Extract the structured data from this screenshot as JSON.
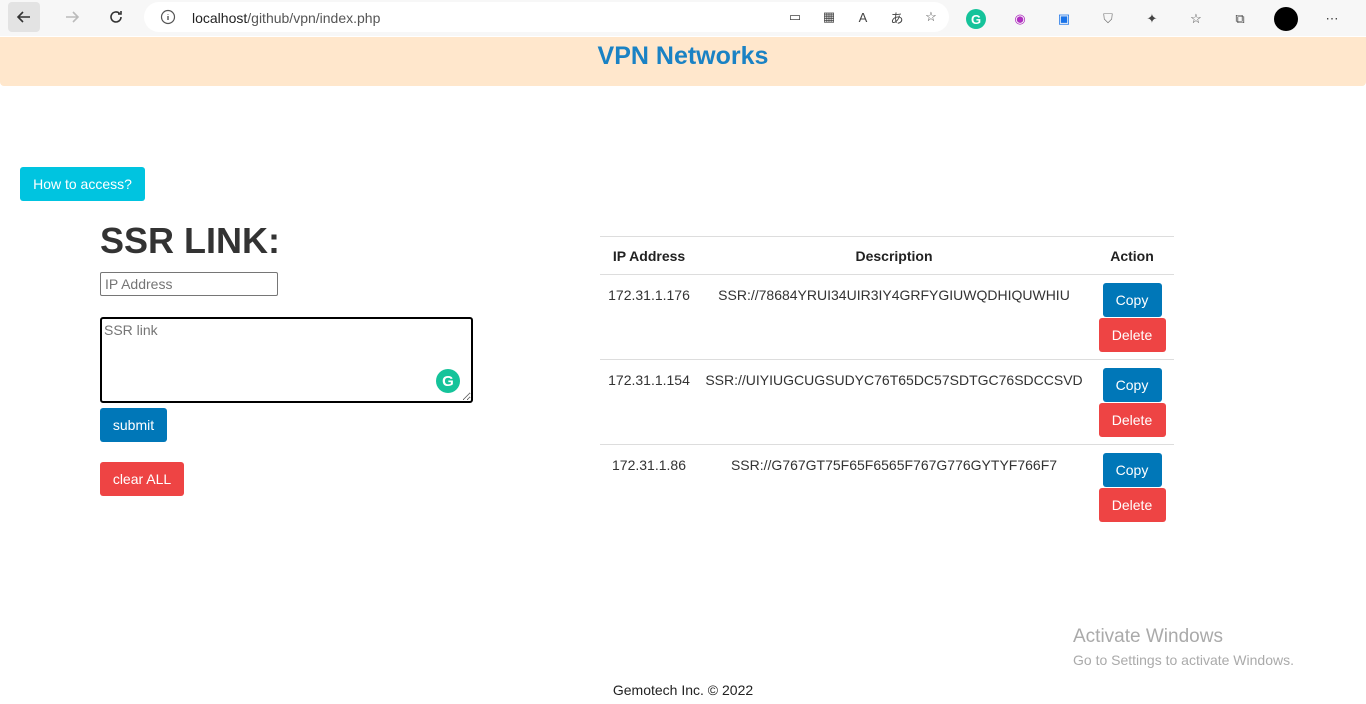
{
  "browser": {
    "url_host": "localhost",
    "url_path": "/github/vpn/index.php",
    "accent": "#15c39a"
  },
  "header": {
    "title": "VPN Networks",
    "background": "#ffe7cc",
    "title_color": "#1a82c4"
  },
  "help_button": "How to access?",
  "form": {
    "title": "SSR LINK:",
    "ip_placeholder": "IP Address",
    "ssr_placeholder": "SSR link",
    "submit_label": "submit",
    "clear_label": "clear ALL"
  },
  "table": {
    "headers": [
      "IP Address",
      "Description",
      "Action"
    ],
    "rows": [
      {
        "ip": "172.31.1.176",
        "description": "SSR://78684YRUI34UIR3IY4GRFYGIUWQDHIQUWHIU",
        "copy": "Copy",
        "delete": "Delete"
      },
      {
        "ip": "172.31.1.154",
        "description": "SSR://UIYIUGCUGSUDYC76T65DC57SDTGC76SDCCSVD",
        "copy": "Copy",
        "delete": "Delete"
      },
      {
        "ip": "172.31.1.86",
        "description": "SSR://G767GT75F65F6565F767G776GYTYF766F7",
        "copy": "Copy",
        "delete": "Delete"
      }
    ]
  },
  "watermark": {
    "line1": "Activate Windows",
    "line2": "Go to Settings to activate Windows."
  },
  "footer": "Gemotech Inc. © 2022"
}
